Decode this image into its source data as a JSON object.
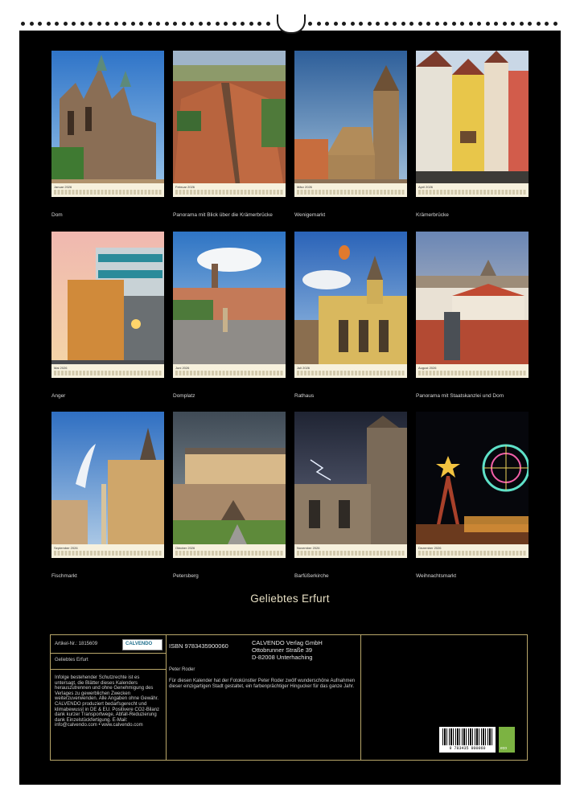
{
  "months": [
    {
      "label": "Januar 2026",
      "caption": "Dom"
    },
    {
      "label": "Februar 2026",
      "caption": "Panorama mit Blick über die Krämerbrücke"
    },
    {
      "label": "März 2026",
      "caption": "Wenigemarkt"
    },
    {
      "label": "April 2026",
      "caption": "Krämerbrücke"
    },
    {
      "label": "Mai 2026",
      "caption": "Anger"
    },
    {
      "label": "Juni 2026",
      "caption": "Domplatz"
    },
    {
      "label": "Juli 2026",
      "caption": "Rathaus"
    },
    {
      "label": "August 2026",
      "caption": "Panorama mit Staatskanzlei und Dom"
    },
    {
      "label": "September 2026",
      "caption": "Fischmarkt"
    },
    {
      "label": "Oktober 2026",
      "caption": "Petersberg"
    },
    {
      "label": "November 2026",
      "caption": "Barfüßerkirche"
    },
    {
      "label": "Dezember 2026",
      "caption": "Weihnachtsmarkt"
    }
  ],
  "title": "Geliebtes Erfurt",
  "info": {
    "article": "Artikel-Nr.: 1815609",
    "calvendo_logo": "CALVENDO",
    "short_title": "Geliebtes Erfurt",
    "legal": "Infolge bestehender Schutzrechte ist es untersagt, die Blätter dieses Kalenders herauszutrennen und ohne Genehmigung des Verlages zu gewerblichen Zwecken weiterzuverwenden. Alle Angaben ohne Gewähr. CALVENDO produziert bedarfsgerecht und klimabewusst in DE & EU. Positivere CO2-Bilanz dank kurzer Transportwege, Abfall-Reduzierung dank Einzelstückfertigung. E-Mail: info@calvendo.com • www.calvendo.com",
    "isbn": "ISBN 9783435900060",
    "publisher": [
      "CALVENDO Verlag GmbH",
      "Ottobrunner Straße 39",
      "D-82008 Unterhaching"
    ],
    "author": "Peter Roder",
    "description": "Für diesen Kalender hat der Fotokünstler Peter Roder zwölf wunderschöne Aufnahmen dieser einzigartigen Stadt gestaltet, ein farbenprächtiger Hingucker für das ganze Jahr.",
    "barcode_number": "9 783435 900060",
    "eco_label": "eco"
  },
  "colors": {
    "background": "#000000",
    "gold": "#b9a76a",
    "title": "#e8e0c4"
  }
}
